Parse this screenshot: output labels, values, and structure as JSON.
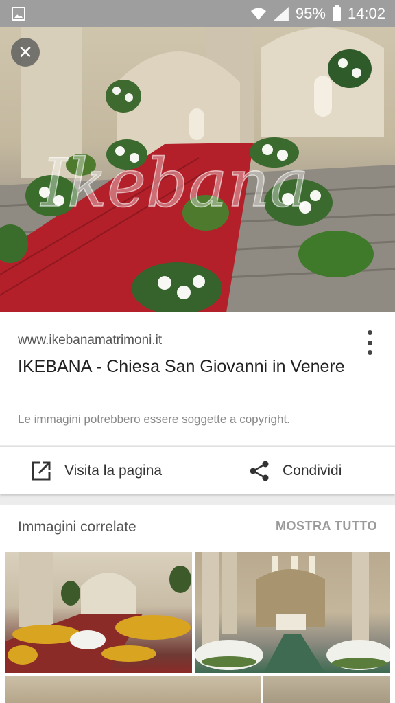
{
  "status_bar": {
    "battery_percent": "95%",
    "time": "14:02",
    "icons": [
      "gallery-icon",
      "wifi-icon",
      "signal-icon",
      "battery-icon"
    ]
  },
  "hero": {
    "watermark": "Ikebana",
    "close_icon": "close-icon"
  },
  "result": {
    "site": "www.ikebanamatrimoni.it",
    "title": "IKEBANA - Chiesa San Giovanni in Venere",
    "copyright_notice": "Le immagini potrebbero essere soggette a copyright."
  },
  "actions": {
    "visit_label": "Visita la pagina",
    "share_label": "Condividi"
  },
  "related": {
    "title": "Immagini correlate",
    "show_all": "MOSTRA TUTTO"
  },
  "colors": {
    "status_bar": "#9e9e9e",
    "carpet_red": "#b3202a",
    "text_primary": "#212121",
    "text_secondary": "#555555"
  }
}
